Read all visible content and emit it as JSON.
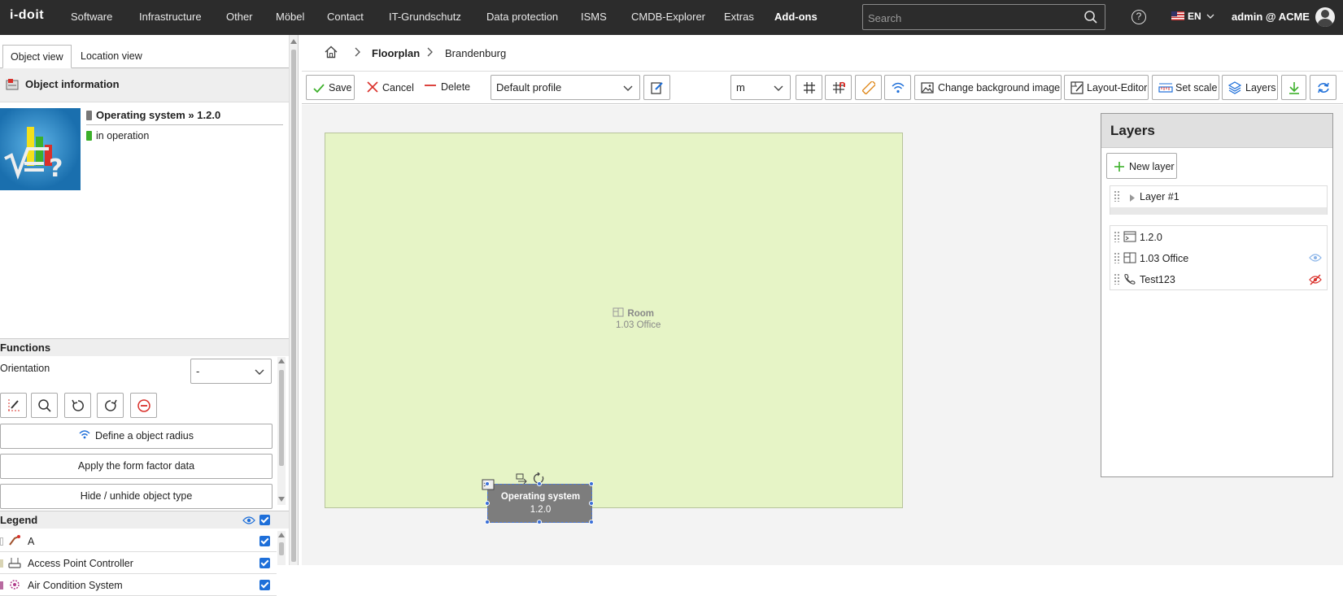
{
  "nav": {
    "logo": "i-doit",
    "items": [
      "Software",
      "Infrastructure",
      "Other",
      "Möbel",
      "Contact",
      "IT-Grundschutz",
      "Data protection",
      "ISMS",
      "CMDB-Explorer",
      "Extras",
      "Add-ons"
    ],
    "search_placeholder": "Search",
    "language": "EN",
    "user": "admin @ ACME"
  },
  "left": {
    "tabs": [
      "Object view",
      "Location view"
    ],
    "object_info_title": "Object information",
    "object_title": "Operating system » 1.2.0",
    "object_status": "in operation",
    "status_color": "#3cb02a",
    "functions_title": "Functions",
    "orientation_label": "Orientation",
    "orientation_value": "-",
    "define_radius": "Define a object radius",
    "apply_form_factor": "Apply the form factor data",
    "hide_unhide": "Hide / unhide object type",
    "legend_title": "Legend",
    "legend": [
      {
        "label": "A",
        "color": "#ffffff"
      },
      {
        "label": "Access Point Controller",
        "color": "#d9d4b4"
      },
      {
        "label": "Air Condition System",
        "color": "#b86aa0"
      }
    ]
  },
  "breadcrumb": [
    "Floorplan",
    "Brandenburg"
  ],
  "toolbar": {
    "save": "Save",
    "cancel": "Cancel",
    "delete": "Delete",
    "profile": "Default profile",
    "unit": "m",
    "change_bg": "Change background image",
    "layout_editor": "Layout-Editor",
    "set_scale": "Set scale",
    "layers": "Layers"
  },
  "canvas": {
    "room_type": "Room",
    "room_name": "1.03 Office",
    "os_type": "Operating system",
    "os_name": "1.2.0"
  },
  "layers_panel": {
    "title": "Layers",
    "new_layer": "New layer",
    "layer_name": "Layer #1",
    "items": [
      "1.2.0",
      "1.03 Office",
      "Test123"
    ]
  },
  "colors": {
    "nav_bg": "#2c2c2c",
    "room_fill": "#e6f4c6",
    "accent": "#1e6fd9",
    "danger": "#d9302a"
  }
}
